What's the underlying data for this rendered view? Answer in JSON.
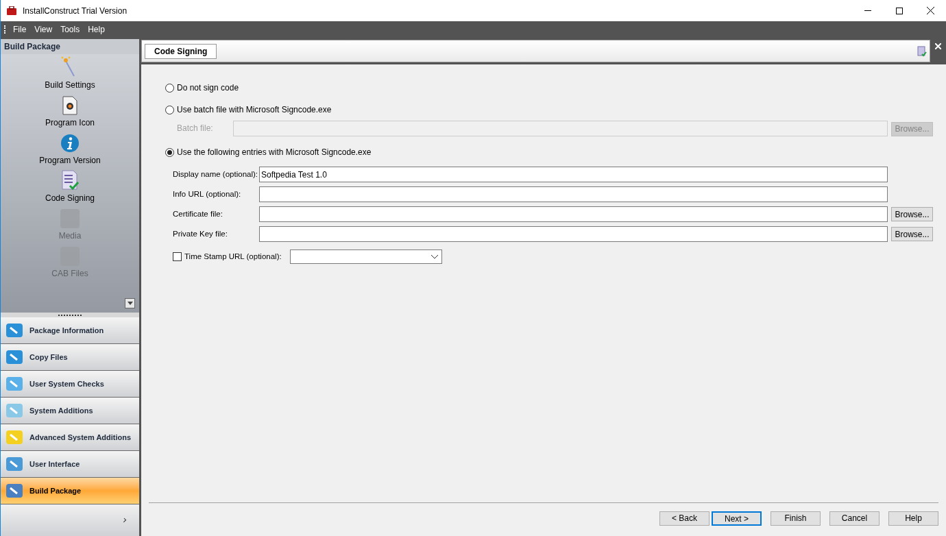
{
  "window": {
    "title": "InstallConstruct Trial Version"
  },
  "menu": [
    "File",
    "View",
    "Tools",
    "Help"
  ],
  "sidebar": {
    "header": "Build Package",
    "tasks": [
      {
        "label": "Build Settings",
        "disabled": false
      },
      {
        "label": "Program Icon",
        "disabled": false
      },
      {
        "label": "Program Version",
        "disabled": false
      },
      {
        "label": "Code Signing",
        "disabled": false
      },
      {
        "label": "Media",
        "disabled": true
      },
      {
        "label": "CAB Files",
        "disabled": true
      }
    ],
    "nav": [
      {
        "label": "Package Information",
        "selected": false
      },
      {
        "label": "Copy Files",
        "selected": false
      },
      {
        "label": "User System Checks",
        "selected": false
      },
      {
        "label": "System Additions",
        "selected": false
      },
      {
        "label": "Advanced System Additions",
        "selected": false
      },
      {
        "label": "User Interface",
        "selected": false
      },
      {
        "label": "Build Package",
        "selected": true
      }
    ]
  },
  "panel": {
    "tab": "Code Signing",
    "options": [
      {
        "label": "Do not sign code",
        "selected": false
      },
      {
        "label": "Use batch file with Microsoft Signcode.exe",
        "selected": false,
        "batch": {
          "label": "Batch file:",
          "browse": "Browse...",
          "disabled": true
        }
      },
      {
        "label": "Use the following entries with Microsoft Signcode.exe",
        "selected": true
      }
    ],
    "fields": [
      {
        "label": "Display name (optional):",
        "value": "Softpedia Test 1.0"
      },
      {
        "label": "Info URL (optional):"
      },
      {
        "label": "Certificate file:",
        "browse": "Browse..."
      },
      {
        "label": "Private Key file:",
        "browse": "Browse..."
      }
    ],
    "timestamp": {
      "label": "Time Stamp URL (optional):",
      "checked": false
    }
  },
  "buttons": [
    {
      "label": "< Back",
      "focused": false
    },
    {
      "label": "Next >",
      "focused": true
    },
    {
      "label": "Finish",
      "focused": false
    },
    {
      "label": "Cancel",
      "focused": false
    },
    {
      "label": "Help",
      "focused": false
    }
  ]
}
